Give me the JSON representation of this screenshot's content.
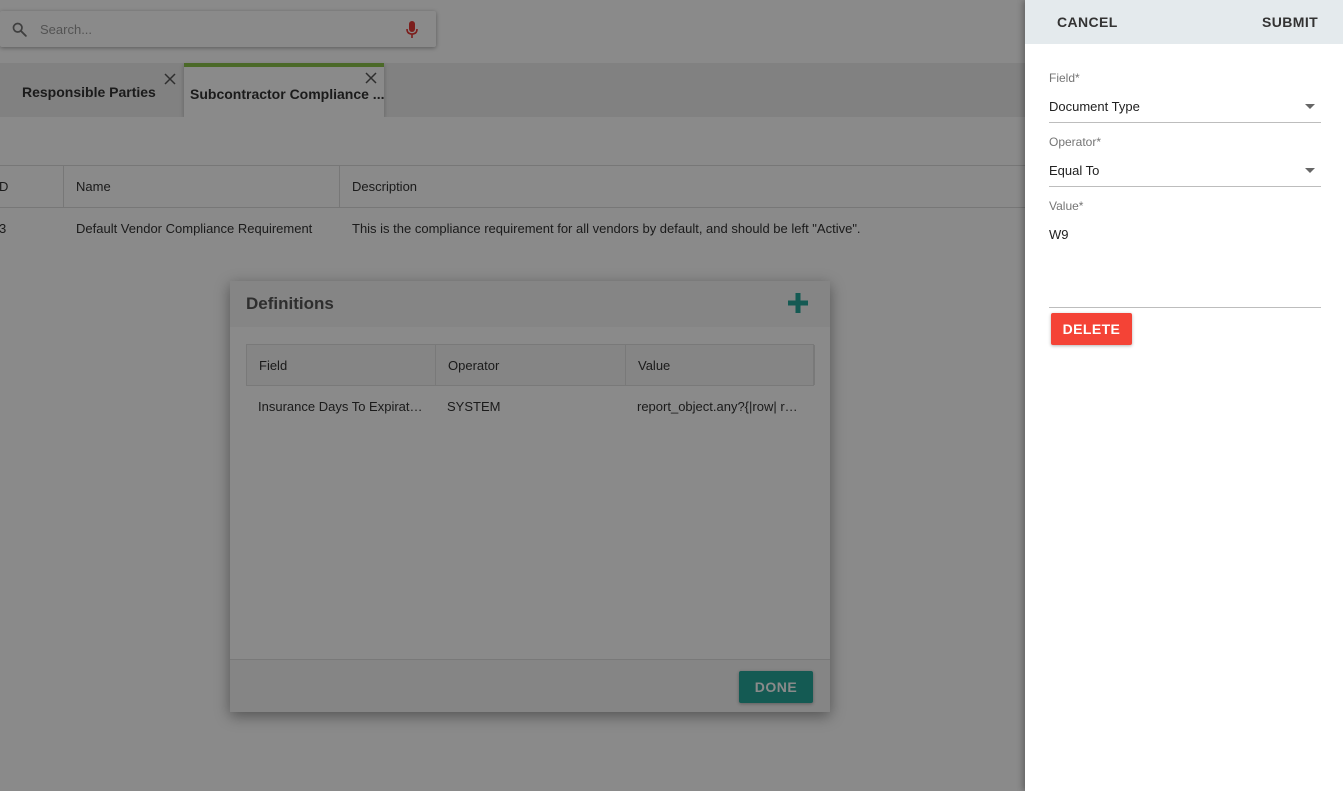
{
  "search": {
    "placeholder": "Search...",
    "icon": "search-icon",
    "mic_icon": "microphone-icon",
    "mic_color": "#e53935"
  },
  "tabs": [
    {
      "label": "Responsible Parties",
      "active": false
    },
    {
      "label": "Subcontractor Compliance ...",
      "active": true
    }
  ],
  "grid": {
    "columns": [
      "D",
      "Name",
      "Description"
    ],
    "rows": [
      {
        "id": "3",
        "name": "Default Vendor Compliance Requirement",
        "description": "This is the compliance requirement for all vendors by default, and should be left \"Active\"."
      }
    ]
  },
  "definitions": {
    "title": "Definitions",
    "add_icon": "plus-icon",
    "accent": "#26a69a",
    "columns": [
      "Field",
      "Operator",
      "Value"
    ],
    "rows": [
      {
        "field": "Insurance Days To Expirati...",
        "operator": "SYSTEM",
        "value": "report_object.any?{|row| ro..."
      }
    ],
    "done_label": "DONE"
  },
  "panel": {
    "cancel_label": "CANCEL",
    "submit_label": "SUBMIT",
    "field_label": "Field*",
    "field_value": "Document Type",
    "operator_label": "Operator*",
    "operator_value": "Equal To",
    "value_label": "Value*",
    "value_value": "W9",
    "delete_label": "DELETE",
    "delete_color": "#f44336",
    "header_color": "#e4eaed"
  }
}
